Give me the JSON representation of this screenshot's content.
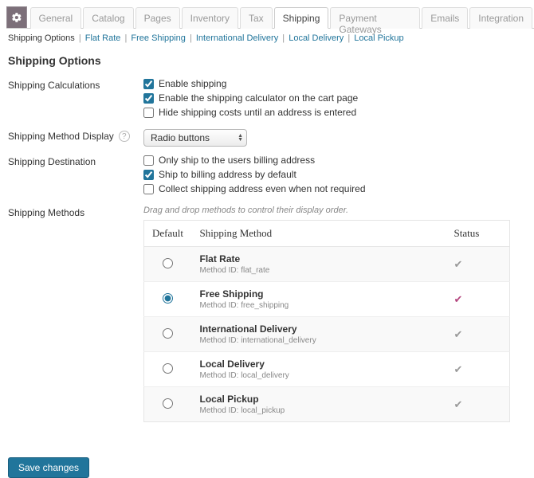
{
  "tabs": [
    "General",
    "Catalog",
    "Pages",
    "Inventory",
    "Tax",
    "Shipping",
    "Payment Gateways",
    "Emails",
    "Integration"
  ],
  "active_tab": 5,
  "subtabs": [
    "Shipping Options",
    "Flat Rate",
    "Free Shipping",
    "International Delivery",
    "Local Delivery",
    "Local Pickup"
  ],
  "active_subtab": 0,
  "page_title": "Shipping Options",
  "section_labels": {
    "calc": "Shipping Calculations",
    "display": "Shipping Method Display",
    "dest": "Shipping Destination",
    "methods": "Shipping Methods"
  },
  "calc_options": [
    {
      "label": "Enable shipping",
      "checked": true
    },
    {
      "label": "Enable the shipping calculator on the cart page",
      "checked": true
    },
    {
      "label": "Hide shipping costs until an address is entered",
      "checked": false
    }
  ],
  "display_select": "Radio buttons",
  "dest_options": [
    {
      "label": "Only ship to the users billing address",
      "checked": false
    },
    {
      "label": "Ship to billing address by default",
      "checked": true
    },
    {
      "label": "Collect shipping address even when not required",
      "checked": false
    }
  ],
  "methods_hint": "Drag and drop methods to control their display order.",
  "methods_headers": {
    "default": "Default",
    "method": "Shipping Method",
    "status": "Status"
  },
  "methods_id_prefix": "Method ID: ",
  "methods": [
    {
      "name": "Flat Rate",
      "id": "flat_rate",
      "default": false,
      "status": true,
      "active": false
    },
    {
      "name": "Free Shipping",
      "id": "free_shipping",
      "default": true,
      "status": true,
      "active": true
    },
    {
      "name": "International Delivery",
      "id": "international_delivery",
      "default": false,
      "status": true,
      "active": false
    },
    {
      "name": "Local Delivery",
      "id": "local_delivery",
      "default": false,
      "status": true,
      "active": false
    },
    {
      "name": "Local Pickup",
      "id": "local_pickup",
      "default": false,
      "status": true,
      "active": false
    }
  ],
  "save_label": "Save changes"
}
